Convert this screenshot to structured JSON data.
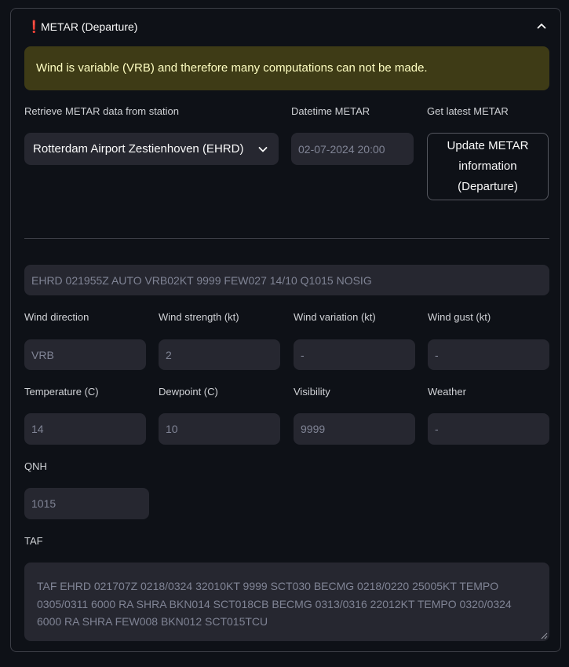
{
  "expander": {
    "icon": "❗",
    "title": "METAR (Departure)"
  },
  "alert": {
    "text": "Wind is variable (VRB) and therefore many computations can not be made."
  },
  "station": {
    "label": "Retrieve METAR data from station",
    "value": "Rotterdam Airport Zestienhoven (EHRD)"
  },
  "datetime": {
    "label": "Datetime METAR",
    "value": "02-07-2024 20:00"
  },
  "latest": {
    "label": "Get latest METAR",
    "button": "Update METAR information (Departure)"
  },
  "metar_raw": "EHRD 021955Z AUTO VRB02KT 9999 FEW027 14/10 Q1015 NOSIG",
  "row1": [
    {
      "label": "Wind direction",
      "value": "VRB"
    },
    {
      "label": "Wind strength (kt)",
      "value": "2"
    },
    {
      "label": "Wind variation (kt)",
      "value": "-"
    },
    {
      "label": "Wind gust (kt)",
      "value": "-"
    }
  ],
  "row2": [
    {
      "label": "Temperature (C)",
      "value": "14"
    },
    {
      "label": "Dewpoint (C)",
      "value": "10"
    },
    {
      "label": "Visibility",
      "value": "9999"
    },
    {
      "label": "Weather",
      "value": "-"
    }
  ],
  "qnh": {
    "label": "QNH",
    "value": "1015"
  },
  "taf": {
    "label": "TAF",
    "value": "TAF EHRD 021707Z 0218/0324 32010KT 9999 SCT030 BECMG 0218/0220 25005KT TEMPO 0305/0311 6000 RA SHRA BKN014 SCT018CB BECMG 0313/0316 22012KT TEMPO 0320/0324 6000 RA SHRA FEW008 BKN012 SCT015TCU"
  },
  "colors": {
    "background": "#0e1117",
    "alert_bg": "#3e3b16",
    "alert_text": "#ffffc2",
    "field_bg": "#262730",
    "warn": "#ff2b2b"
  },
  "icons": {
    "collapse": "chevron-up-icon",
    "dropdown": "chevron-down-icon",
    "warning": "exclamation-icon"
  }
}
